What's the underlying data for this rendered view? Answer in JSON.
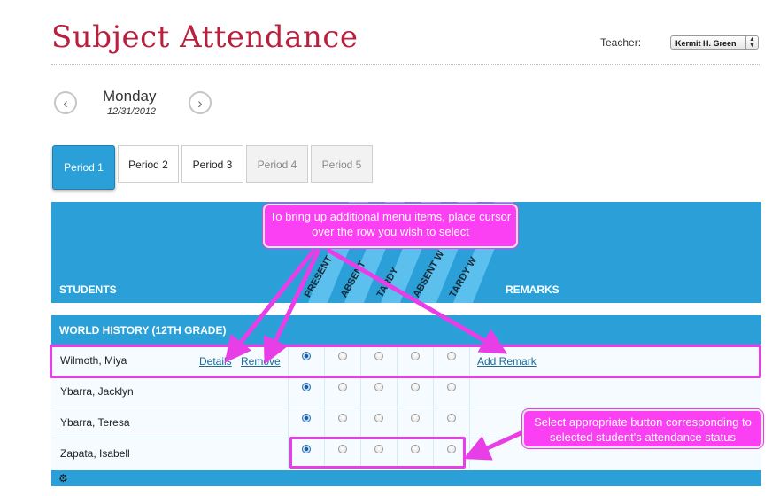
{
  "page": {
    "title": "Subject Attendance"
  },
  "teacher": {
    "label": "Teacher:",
    "selected": "Kermit H. Green"
  },
  "date_nav": {
    "prev_icon": "chevron-left-icon",
    "next_icon": "chevron-right-icon",
    "day": "Monday",
    "date": "12/31/2012"
  },
  "periods": [
    {
      "label": "Period 1",
      "state": "active"
    },
    {
      "label": "Period 2",
      "state": "normal"
    },
    {
      "label": "Period 3",
      "state": "normal"
    },
    {
      "label": "Period 4",
      "state": "disabled"
    },
    {
      "label": "Period 5",
      "state": "disabled"
    }
  ],
  "table": {
    "students_header": "STUDENTS",
    "remarks_header": "REMARKS",
    "status_columns": [
      "PRESENT",
      "ABSENT",
      "TARDY",
      "ABSENT W",
      "TARDY W"
    ],
    "group": "WORLD HISTORY (12TH GRADE)",
    "rows": [
      {
        "name": "Wilmoth, Miya",
        "selected_status": 0,
        "details": "Details",
        "remove": "Remove",
        "add_remark": "Add Remark"
      },
      {
        "name": "Ybarra, Jacklyn",
        "selected_status": 0
      },
      {
        "name": "Ybarra, Teresa",
        "selected_status": 0
      },
      {
        "name": "Zapata, Isabell",
        "selected_status": 0
      }
    ],
    "footer_icon": "gear-icon"
  },
  "annotations": {
    "top_callout": "To bring up additional menu items, place cursor over the row you wish to select",
    "right_callout": "Select appropriate button corresponding to selected student's attendance status",
    "color": "#fb3ff2"
  },
  "colors": {
    "brand_red": "#b8203e",
    "accent_blue": "#2a9fd8",
    "highlight_magenta": "#e83ee8"
  }
}
